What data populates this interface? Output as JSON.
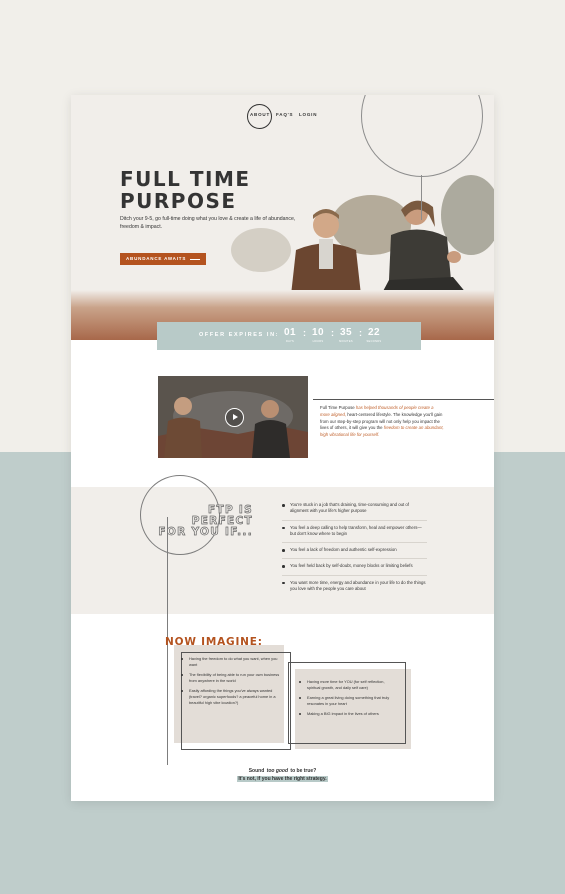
{
  "nav": {
    "about": "ABOUT",
    "faqs": "FAQ'S",
    "login": "LOGIN"
  },
  "hero": {
    "title_line1": "FULL TIME",
    "title_line2": "PURPOSE",
    "subtitle": "Ditch your 9-5, go full-time doing what you love & create a life of abundance, freedom & impact.",
    "button_label": "ABUNDANCE AWAITS"
  },
  "countdown": {
    "label": "OFFER EXPIRES IN:",
    "days": "01",
    "hours": "10",
    "minutes": "35",
    "seconds": "22",
    "days_cap": "DAYS",
    "hours_cap": "HOURS",
    "minutes_cap": "MINUTES",
    "seconds_cap": "SECONDS"
  },
  "video_section": {
    "text_part1": "Full Time Purpose ",
    "text_orange1": "has helped thousands of people create a more aligned,",
    "text_part2": " heart-centered lifestyle. The knowledge you'll gain from our step-by-step program will not only help you impact the lives of others, it will give you the ",
    "text_orange2": "freedom to create an abundant, high vibrational life for yourself."
  },
  "ftp": {
    "title_line1": "FTP IS PERFECT",
    "title_line2": "FOR YOU IF...",
    "items": [
      "You're stuck in a job that's draining, time-consuming and out of alignment with your life's higher purpose",
      "You feel a deep calling to help transform, heal and empower others—but don't know where to begin",
      "You feel a lack of freedom and authentic self-expression",
      "You feel held back by self-doubt, money blocks or limiting beliefs",
      "You want more time, energy and abundance in your life to do the things you love with the people you care about"
    ]
  },
  "now_imagine": {
    "title": "NOW IMAGINE:",
    "left_items": [
      "Having the freedom to do what you want, when you want",
      "The flexibility of being able to run your own business from anywhere in the world",
      "Easily affording the things you've always wanted (travel? organic superfoods? a peaceful home in a beautiful high vibe location?)"
    ],
    "right_items": [
      "Having more time for YOU (for self reflection, spiritual growth, and daily self care)",
      "Earning a great living doing something that truly resonates in your heart",
      "Making a BIG impact in the lives of others"
    ]
  },
  "footer": {
    "line1_a": "Sound ",
    "line1_em": "too good",
    "line1_b": " to be true?",
    "line2": "It's not, if you have the right strategy."
  },
  "colors": {
    "accent": "#b4531f",
    "teal": "#b8cac8",
    "cream": "#f1eeea"
  }
}
